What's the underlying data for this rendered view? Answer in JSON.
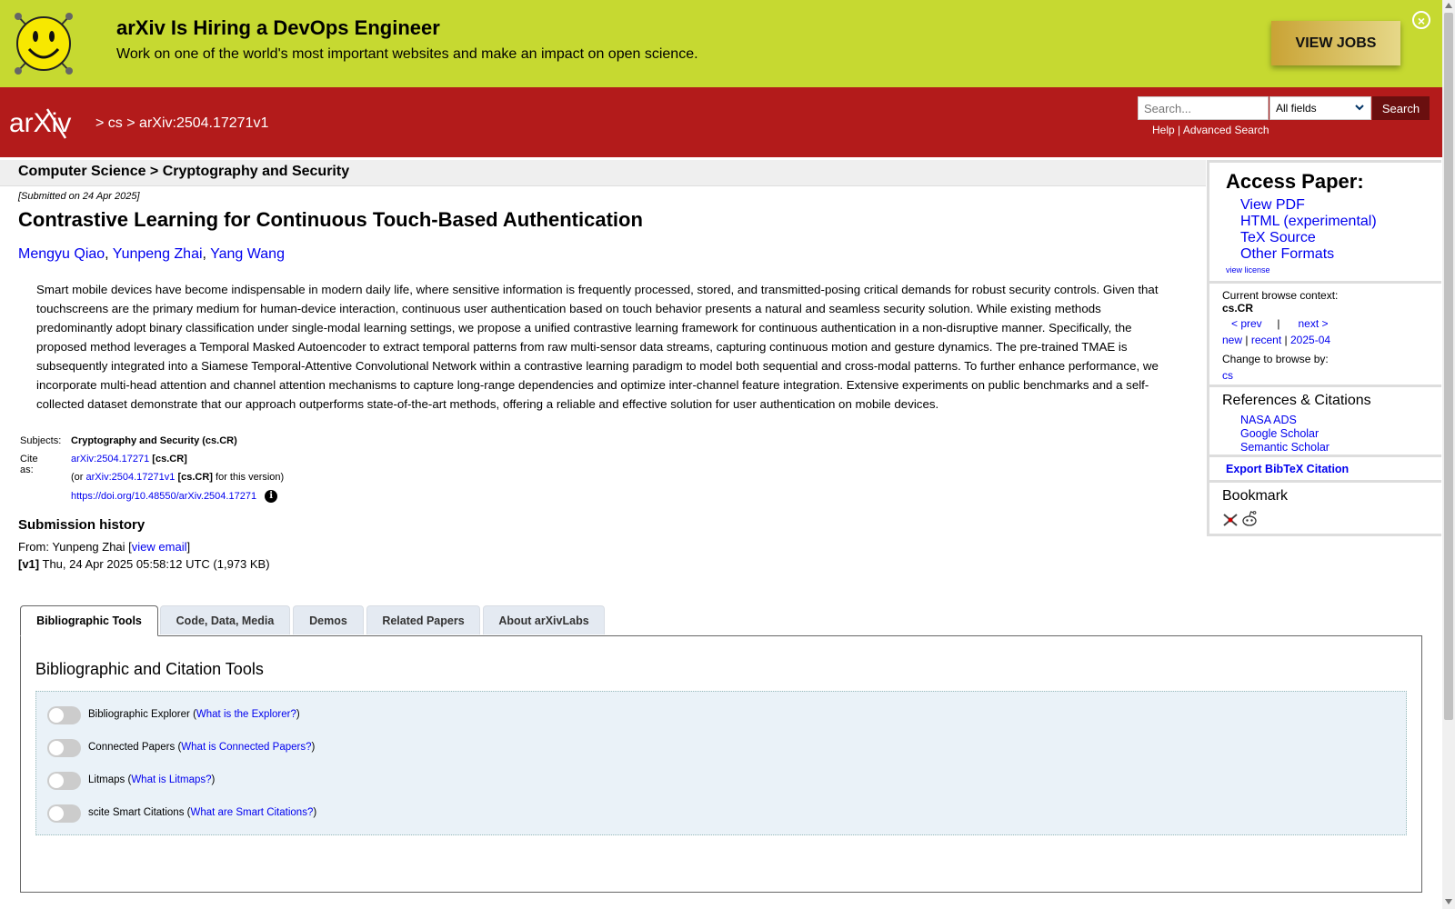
{
  "banner": {
    "title": "arXiv Is Hiring a DevOps Engineer",
    "subtitle": "Work on one of the world's most important websites and make an impact on open science.",
    "cta_label": "VIEW JOBS",
    "close_icon": "close-circle-icon"
  },
  "header": {
    "logo_text": "arXiv",
    "crumb_sep": ">",
    "crumb_cs": "cs",
    "crumb_id": "arXiv:2504.17271v1",
    "search_placeholder": "Search...",
    "search_field": "All fields",
    "search_button": "Search",
    "help": "Help",
    "link_sep": "|",
    "advanced": "Advanced Search",
    "bg_color": "#b31b1b"
  },
  "category": "Computer Science > Cryptography and Security",
  "paper": {
    "submitted": "[Submitted on 24 Apr 2025]",
    "title": "Contrastive Learning for Continuous Touch-Based Authentication",
    "authors": [
      "Mengyu Qiao",
      "Yunpeng Zhai",
      "Yang Wang"
    ],
    "abstract": "Smart mobile devices have become indispensable in modern daily life, where sensitive information is frequently processed, stored, and transmitted-posing critical demands for robust security controls. Given that touchscreens are the primary medium for human-device interaction, continuous user authentication based on touch behavior presents a natural and seamless security solution. While existing methods predominantly adopt binary classification under single-modal learning settings, we propose a unified contrastive learning framework for continuous authentication in a non-disruptive manner. Specifically, the proposed method leverages a Temporal Masked Autoencoder to extract temporal patterns from raw multi-sensor data streams, capturing continuous motion and gesture dynamics. The pre-trained TMAE is subsequently integrated into a Siamese Temporal-Attentive Convolutional Network within a contrastive learning paradigm to model both sequential and cross-modal patterns. To further enhance performance, we incorporate multi-head attention and channel attention mechanisms to capture long-range dependencies and optimize inter-channel feature integration. Extensive experiments on public benchmarks and a self-collected dataset demonstrate that our approach outperforms state-of-the-art methods, offering a reliable and effective solution for user authentication on mobile devices."
  },
  "meta": {
    "subjects_label": "Subjects:",
    "subjects_value": "Cryptography and Security (cs.CR)",
    "cite_label": "Cite as:",
    "cite_id": "arXiv:2504.17271",
    "cite_cat": "[cs.CR]",
    "or_prefix": "(or",
    "or_id": "arXiv:2504.17271v1",
    "or_cat": "[cs.CR]",
    "or_suffix": "for this version)",
    "doi": "https://doi.org/10.48550/arXiv.2504.17271",
    "info_glyph": "i"
  },
  "history": {
    "title": "Submission history",
    "from_prefix": "From: Yunpeng Zhai [",
    "view_email": "view email",
    "from_suffix": "]",
    "v1_label": "[v1]",
    "v1_text": "Thu, 24 Apr 2025 05:58:12 UTC (1,973 KB)"
  },
  "sidebar": {
    "access_title": "Access Paper:",
    "access_links": [
      "View PDF",
      "HTML (experimental)",
      "TeX Source",
      "Other Formats"
    ],
    "view_license": "view license",
    "ctx_label": "Current browse context:",
    "ctx_value": "cs.CR",
    "prev": "< prev",
    "nav_sep": "|",
    "next": "next >",
    "new": "new",
    "recent": "recent",
    "month": "2025-04",
    "change_label": "Change to browse by:",
    "change_value": "cs",
    "refs_title": "References & Citations",
    "refs_links": [
      "NASA ADS",
      "Google Scholar",
      "Semantic Scholar"
    ],
    "export": "Export BibTeX Citation",
    "bookmark_title": "Bookmark",
    "bookmark_icons": [
      "bibsonomy-icon",
      "reddit-icon"
    ]
  },
  "tabs": [
    "Bibliographic Tools",
    "Code, Data, Media",
    "Demos",
    "Related Papers",
    "About arXivLabs"
  ],
  "active_tab": "Bibliographic Tools",
  "panel": {
    "title": "Bibliographic and Citation Tools",
    "tools": [
      {
        "name": "Bibliographic Explorer",
        "link": "What is the Explorer?"
      },
      {
        "name": "Connected Papers",
        "link": "What is Connected Papers?"
      },
      {
        "name": "Litmaps",
        "link": "What is Litmaps?"
      },
      {
        "name": "scite Smart Citations",
        "link": "What are Smart Citations?"
      }
    ]
  }
}
